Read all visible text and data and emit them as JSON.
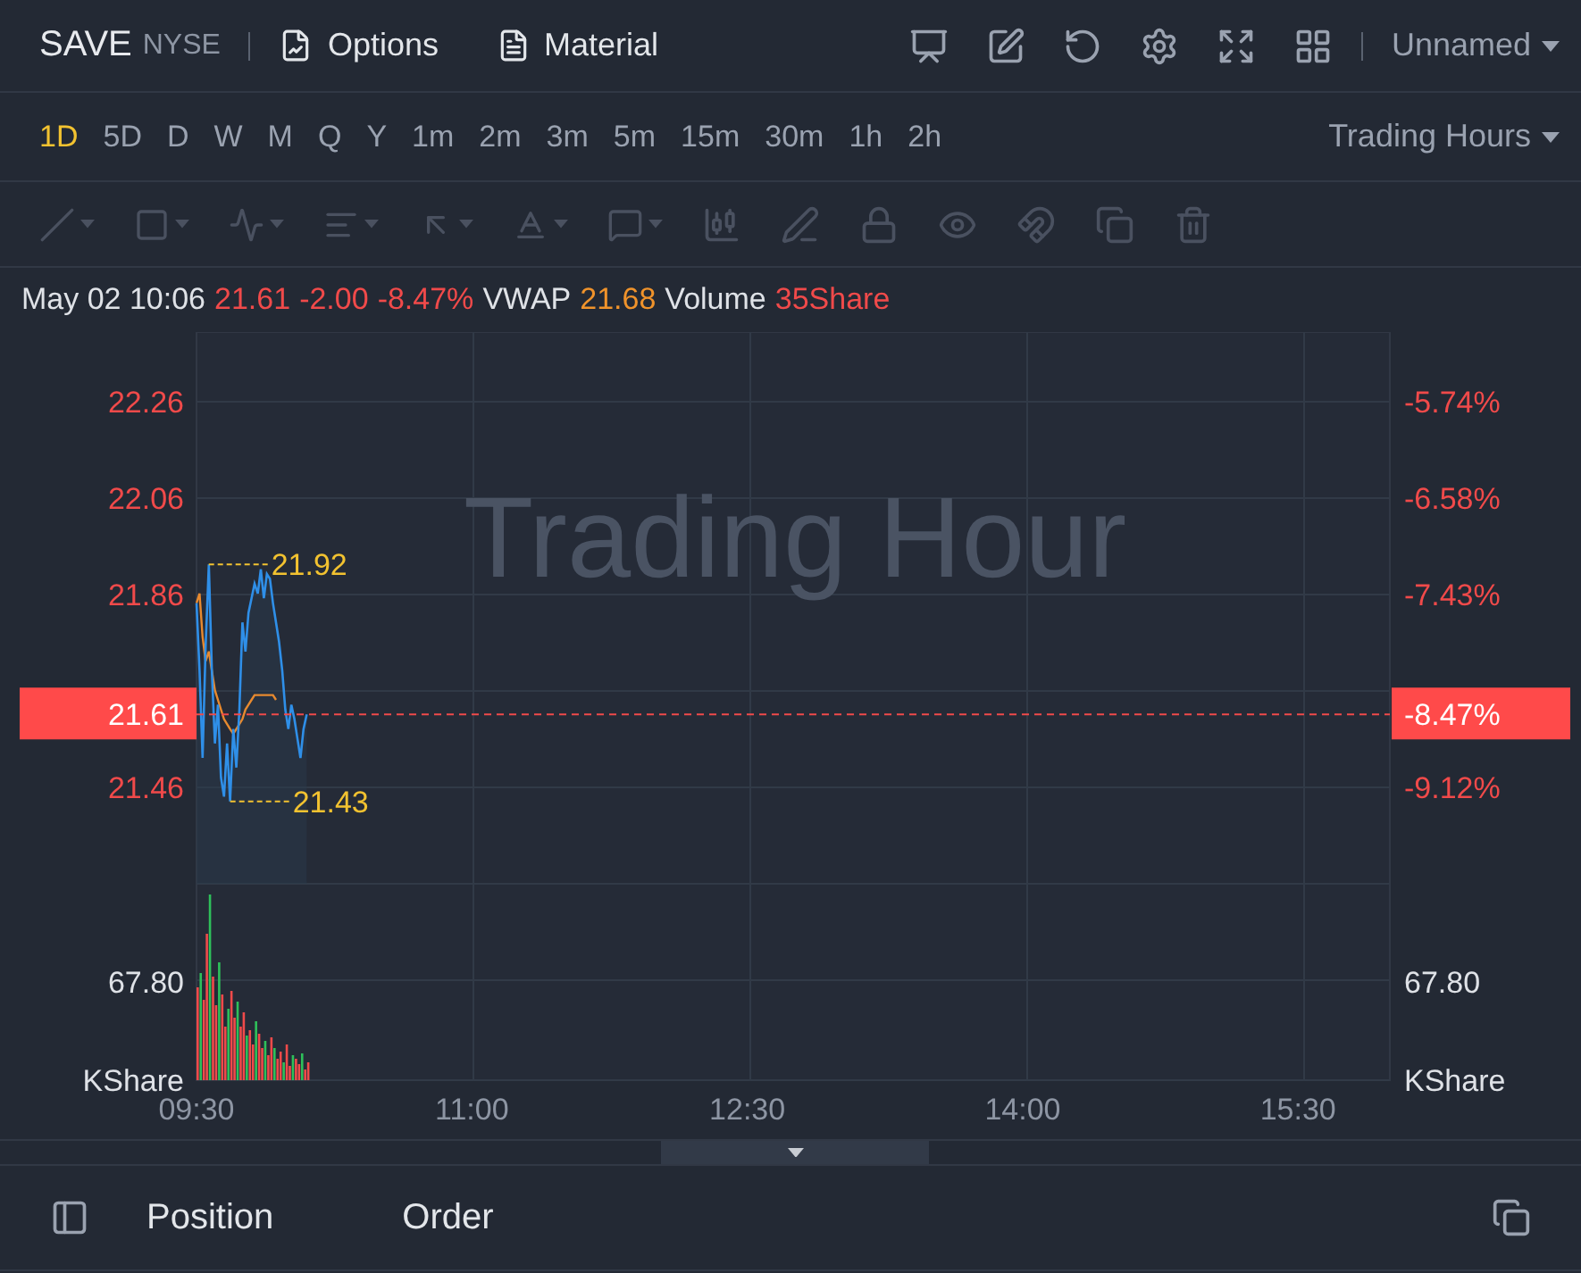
{
  "header": {
    "symbol": "SAVE",
    "exchange": "NYSE",
    "menu": [
      {
        "label": "Options",
        "kind": "options"
      },
      {
        "label": "Material",
        "kind": "material"
      }
    ],
    "layout": "Unnamed"
  },
  "periods": [
    {
      "label": "1D",
      "selected": true
    },
    {
      "label": "5D",
      "selected": false
    },
    {
      "label": "D",
      "selected": false
    },
    {
      "label": "W",
      "selected": false
    },
    {
      "label": "M",
      "selected": false
    },
    {
      "label": "Q",
      "selected": false
    },
    {
      "label": "Y",
      "selected": false
    },
    {
      "label": "1m",
      "selected": false
    },
    {
      "label": "2m",
      "selected": false
    },
    {
      "label": "3m",
      "selected": false
    },
    {
      "label": "5m",
      "selected": false
    },
    {
      "label": "15m",
      "selected": false
    },
    {
      "label": "30m",
      "selected": false
    },
    {
      "label": "1h",
      "selected": false
    },
    {
      "label": "2h",
      "selected": false
    }
  ],
  "session": "Trading Hours",
  "quote": [
    {
      "text": "May 02 10:06",
      "color": "#dfe2e7"
    },
    {
      "text": "21.61",
      "color": "#f04a4a"
    },
    {
      "text": "-2.00",
      "color": "#f04a4a"
    },
    {
      "text": "-8.47%",
      "color": "#f04a4a"
    },
    {
      "text": "VWAP",
      "color": "#dfe2e7"
    },
    {
      "text": "21.68",
      "color": "#f0932b"
    },
    {
      "text": "Volume",
      "color": "#dfe2e7"
    },
    {
      "text": "35Share",
      "color": "#f04a4a"
    }
  ],
  "chart": {
    "watermark": "Trading Hour",
    "price_marker": {
      "price": "21.61",
      "change": "-8.47%"
    },
    "price_labels": [
      "22.26",
      "22.06",
      "21.86",
      "21.46"
    ],
    "percent_labels": [
      "-5.74%",
      "-6.58%",
      "-7.43%",
      "-9.12%"
    ],
    "high_label": "21.92",
    "low_label": "21.43",
    "time_labels": [
      "09:30",
      "11:00",
      "12:30",
      "14:00",
      "15:30"
    ],
    "volume": {
      "left_tick": "67.80",
      "right_tick": "67.80",
      "left_unit": "KShare",
      "right_unit": "KShare"
    }
  },
  "bottom": {
    "tabs": [
      "Position",
      "Order"
    ]
  }
}
